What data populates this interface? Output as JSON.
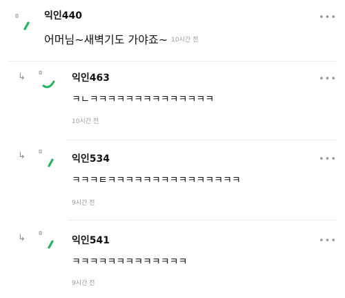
{
  "comments": [
    {
      "author": "익인440",
      "text": "어머님~새벽기도 가야죠~",
      "time": "10시간 전",
      "is_reply": false
    },
    {
      "author": "익인463",
      "text": "ㅋㄴㅋㅋㅋㅋㅋㅋㅋㅋㅋㅋㅋㅋㅋㅋ",
      "time": "10시간 전",
      "is_reply": true
    },
    {
      "author": "익인534",
      "text": "ㅋㅋㅋㅌㅋㅋㅋㅋㅋㅋㅋㅋㅋㅋㅋㅋㅋㅋㅋ",
      "time": "9시간 전",
      "is_reply": true
    },
    {
      "author": "익인541",
      "text": "ㅋㅋㅋㅋㅋㅋㅋㅋㅋㅋㅋㅋㅋ",
      "time": "9시간 전",
      "is_reply": true
    }
  ],
  "more_glyph": "•••",
  "reply_glyph": "↳",
  "icons": {
    "avatar": "avatar-icon",
    "reply": "reply-arrow-icon",
    "more": "more-options-icon"
  },
  "colors": {
    "accent_green": "#22b35e",
    "muted": "#9a9a9a",
    "divider": "#ececec"
  }
}
